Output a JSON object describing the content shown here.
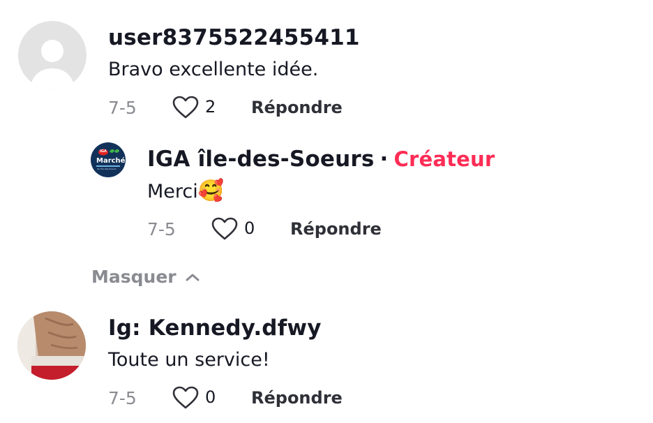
{
  "comments": [
    {
      "username": "user8375522455411",
      "text": "Bravo excellente idée.",
      "date": "7-5",
      "likes": "2",
      "reply_label": "Répondre",
      "avatar": "default-person-avatar"
    },
    {
      "username": "Ig: Kennedy.dfwy",
      "text": "Toute un service!",
      "date": "7-5",
      "likes": "0",
      "reply_label": "Répondre",
      "avatar": "photo-avatar"
    }
  ],
  "reply": {
    "username": "IGA île-des-Soeurs",
    "separator": "·",
    "creator_badge": "Créateur",
    "text": "Merci",
    "emoji": "🥰",
    "date": "7-5",
    "likes": "0",
    "reply_label": "Répondre",
    "avatar": "iga-logo-avatar",
    "avatar_logo_text": "Marché",
    "avatar_logo_subtext": "de l'île-des-Soeurs",
    "avatar_logo_badge": "IGA"
  },
  "hide_replies": {
    "label": "Masquer",
    "icon": "chevron-up-icon"
  },
  "colors": {
    "creator": "#fe2c55",
    "text": "#161823",
    "muted": "#8a8b91"
  }
}
